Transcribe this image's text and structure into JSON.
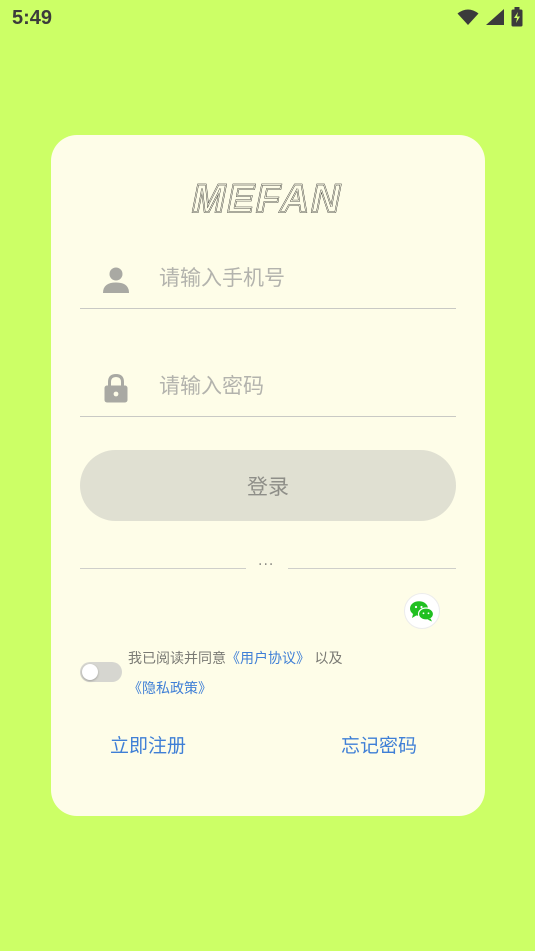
{
  "status_bar": {
    "time": "5:49",
    "icons": [
      "wifi-icon",
      "signal-icon",
      "battery-charging-icon"
    ]
  },
  "app": {
    "logo_text": "MEFAN"
  },
  "login_form": {
    "phone_placeholder": "请输入手机号",
    "phone_value": "",
    "phone_icon": "user-icon",
    "password_placeholder": "请输入密码",
    "password_value": "",
    "password_icon": "lock-icon",
    "login_label": "登录"
  },
  "third_party": {
    "divider_text": "···",
    "wechat_icon": "wechat-icon"
  },
  "agreement": {
    "checked": false,
    "prefix": "我已阅读并同意",
    "user_agreement": "《用户协议》",
    "conjunction": "以及",
    "privacy_policy": "《隐私政策》"
  },
  "footer_links": {
    "register": "立即注册",
    "forgot_password": "忘记密码"
  },
  "colors": {
    "background": "#ccff66",
    "card": "#fefde8",
    "link": "#3f7fd6",
    "button_disabled": "#e0e0d2",
    "wechat_green": "#20c020"
  }
}
